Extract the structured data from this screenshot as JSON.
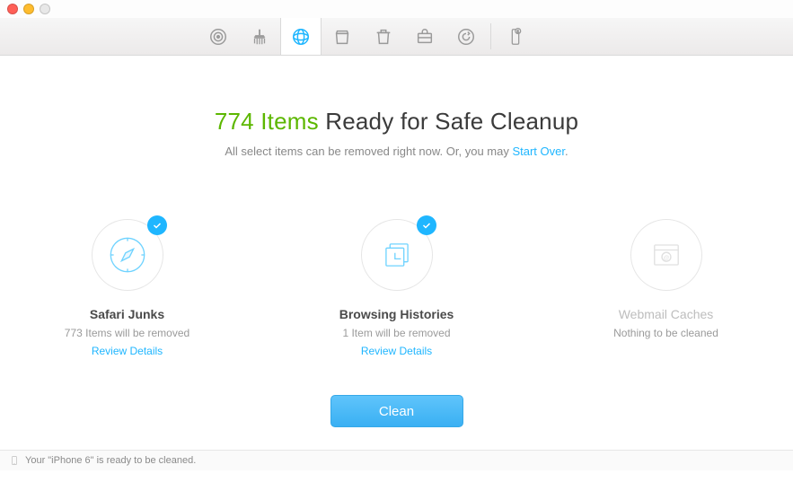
{
  "headline": {
    "count_text": "774 Items",
    "rest": " Ready for Safe Cleanup"
  },
  "subline": {
    "text_before": "All select items can be removed right now. Or, you may ",
    "link": "Start Over",
    "text_after": "."
  },
  "cards": [
    {
      "title": "Safari Junks",
      "sub": "773 Items will be removed",
      "link": "Review Details"
    },
    {
      "title": "Browsing Histories",
      "sub": "1 Item will be removed",
      "link": "Review Details"
    },
    {
      "title": "Webmail Caches",
      "sub": "Nothing to be cleaned"
    }
  ],
  "clean_button": "Clean",
  "status": "Your \"iPhone 6\" is ready to be cleaned."
}
